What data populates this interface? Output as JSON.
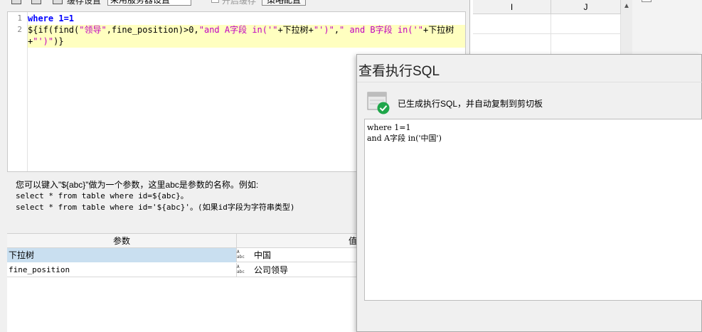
{
  "toolbar": {
    "label_a": "缓存设置",
    "select_value": "采用服务器设置",
    "check_label": "开启缓存",
    "button_label": "策略配置"
  },
  "editor": {
    "line_numbers": [
      "1",
      "2"
    ],
    "line1": "where 1=1",
    "line2a_prefix": "${if(find(",
    "line2a_str1": "\"领导\"",
    "line2a_mid": ",fine_position)>0,",
    "line2a_str2": "\"and A字段 in('\"",
    "line2a_plus": "+下拉树+",
    "line2a_str3": "\"')\"",
    "line2a_comma": ",",
    "line2a_str4": "\" and B字段 in('\"",
    "line2a_tail": "+下拉树",
    "line2b_plus": "+",
    "line2b_str": "\"')\"",
    "line2b_end": ")}"
  },
  "hint": {
    "line1": "您可以键入\"${abc}\"做为一个参数，这里abc是参数的名称。例如:",
    "line2": "select * from table where id=${abc}。",
    "line3": "select * from table where id='${abc}'。(如果id字段为字符串类型)"
  },
  "params": {
    "header_param": "参数",
    "header_value": "值",
    "rows": [
      {
        "name": "下拉树",
        "type_icon": "abc",
        "value": "中国",
        "selected": true
      },
      {
        "name": "fine_position",
        "type_icon": "abc",
        "value": "公司领导",
        "selected": false
      }
    ]
  },
  "grid": {
    "columns": [
      "I",
      "J"
    ]
  },
  "dialog": {
    "title": "查看执行SQL",
    "info": "已生成执行SQL，并自动复制到剪切板",
    "sql_lines": [
      "where 1=1",
      "and A字段 in('中国')"
    ]
  },
  "colors": {
    "keyword": "#0000ff",
    "string": "#c000c0",
    "current_line": "#ffffc0",
    "selected_row": "#c9dff0",
    "success_green": "#1fa64a"
  }
}
